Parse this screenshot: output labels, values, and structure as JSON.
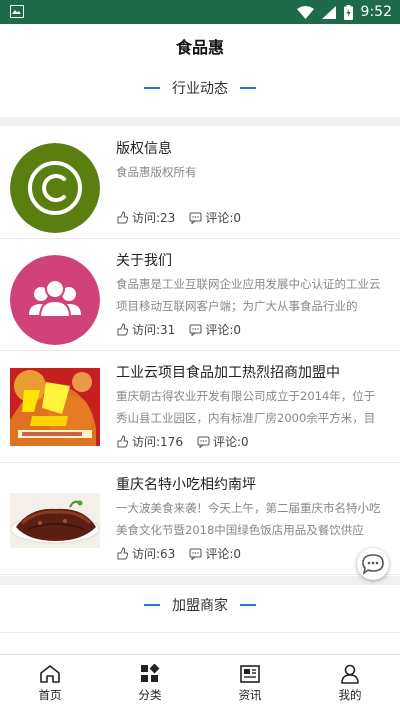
{
  "status_bar": {
    "time": "9:52",
    "background": "#1d6b4a"
  },
  "header": {
    "title": "食品惠"
  },
  "sections": [
    {
      "title": "行业动态"
    },
    {
      "title": "加盟商家"
    }
  ],
  "news": [
    {
      "title": "版权信息",
      "desc": "食品惠版权所有",
      "visits": "访问:23",
      "comments": "评论:0",
      "thumb": "copyright-icon",
      "thumb_color": "#5b7e10"
    },
    {
      "title": "关于我们",
      "desc": "食品惠是工业互联网企业应用发展中心认证的工业云项目移动互联网客户端；为广大从事食品行业的",
      "visits": "访问:31",
      "comments": "评论:0",
      "thumb": "users-icon",
      "thumb_color": "#d1427b"
    },
    {
      "title": "工业云项目食品加工热烈招商加盟中",
      "desc": "重庆朝古得农业开发有限公司成立于2014年，位于秀山县工业园区，内有标准厂房2000余平方米，目",
      "visits": "访问:176",
      "comments": "评论:0",
      "thumb": "recruitment-banner",
      "thumb_color": "#d8262b"
    },
    {
      "title": "重庆名特小吃相约南坪",
      "desc": "一大波美食来袭！今天上午，第二届重庆市名特小吃美食文化节暨2018中国绿色饭店用品及餐饮供应",
      "visits": "访问:63",
      "comments": "评论:0",
      "thumb": "food-photo",
      "thumb_color": "#6b2a1a"
    }
  ],
  "tabs": [
    {
      "label": "首页",
      "icon": "home-icon"
    },
    {
      "label": "分类",
      "icon": "category-icon"
    },
    {
      "label": "资讯",
      "icon": "news-icon"
    },
    {
      "label": "我的",
      "icon": "profile-icon"
    }
  ]
}
